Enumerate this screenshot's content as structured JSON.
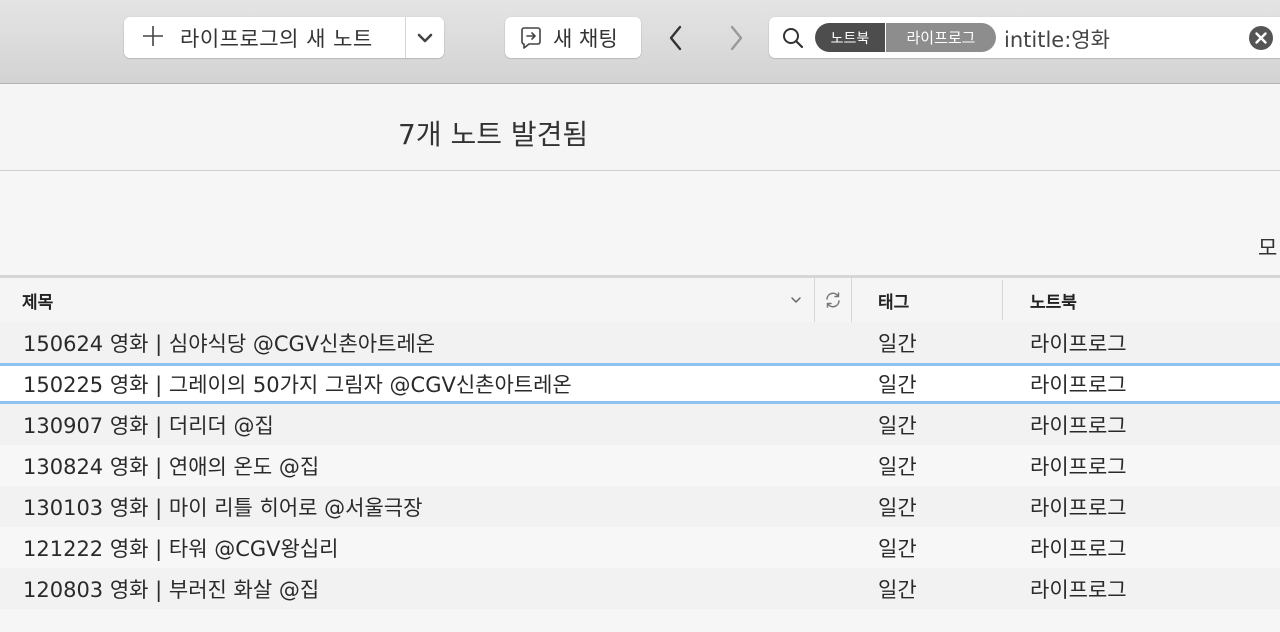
{
  "toolbar": {
    "new_note_label": "라이프로그의 새 노트",
    "new_chat_label": "새 채팅"
  },
  "search": {
    "token_notebook": "노트북",
    "token_value": "라이프로그",
    "query": "intitle:영화"
  },
  "results": {
    "count_label": "7개 노트 발견됨",
    "sort_label_partial": "모"
  },
  "table": {
    "columns": {
      "title": "제목",
      "tag": "태그",
      "notebook": "노트북"
    },
    "rows": [
      {
        "title": "150624 영화 | 심야식당 @CGV신촌아트레온",
        "tag": "일간",
        "notebook": "라이프로그",
        "selected": false
      },
      {
        "title": "150225 영화 | 그레이의 50가지 그림자 @CGV신촌아트레온",
        "tag": "일간",
        "notebook": "라이프로그",
        "selected": true
      },
      {
        "title": "130907 영화 | 더리더 @집",
        "tag": "일간",
        "notebook": "라이프로그",
        "selected": false
      },
      {
        "title": "130824 영화 | 연애의 온도 @집",
        "tag": "일간",
        "notebook": "라이프로그",
        "selected": false
      },
      {
        "title": "130103 영화 | 마이 리틀 히어로 @서울극장",
        "tag": "일간",
        "notebook": "라이프로그",
        "selected": false
      },
      {
        "title": "121222 영화 | 타워 @CGV왕십리",
        "tag": "일간",
        "notebook": "라이프로그",
        "selected": false
      },
      {
        "title": "120803 영화 | 부러진 화살 @집",
        "tag": "일간",
        "notebook": "라이프로그",
        "selected": false
      }
    ]
  },
  "colors": {
    "selection_border": "#8ec3ef",
    "token_dark": "#4d4d4d",
    "token_light": "#8d8d8d"
  }
}
